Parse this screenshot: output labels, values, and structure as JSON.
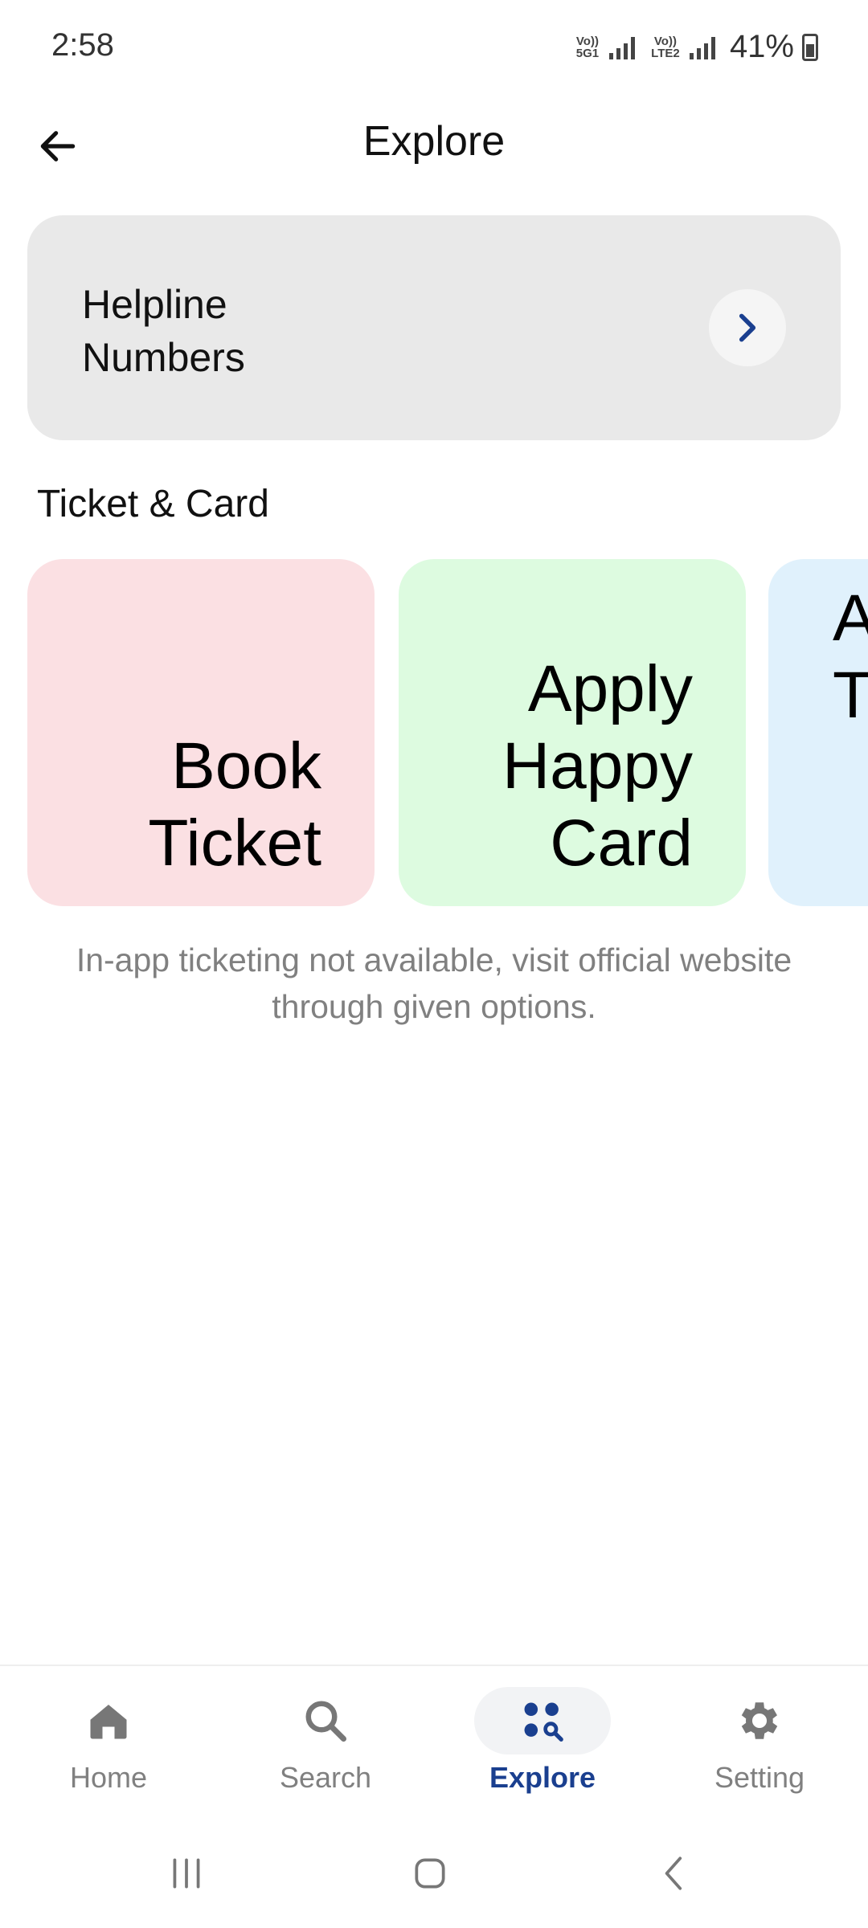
{
  "status_bar": {
    "time": "2:58",
    "net1": "Vo)) 5G1",
    "net2": "Vo)) LTE2",
    "battery": "41%"
  },
  "header": {
    "title": "Explore"
  },
  "helpline": {
    "label": "Helpline Numbers"
  },
  "section": {
    "title": "Ticket & Card"
  },
  "tiles": [
    {
      "label": "Book Ticket",
      "color": "#fbe0e3"
    },
    {
      "label": "Apply Happy Card",
      "color": "#ddfbe0"
    },
    {
      "label": "A T",
      "color": "#e0f1fc"
    }
  ],
  "note": "In-app ticketing not available, visit official website through given options.",
  "bottom_nav": {
    "items": [
      {
        "label": "Home",
        "icon": "home-icon"
      },
      {
        "label": "Search",
        "icon": "search-icon"
      },
      {
        "label": "Explore",
        "icon": "explore-icon",
        "active": true
      },
      {
        "label": "Setting",
        "icon": "gear-icon"
      }
    ]
  },
  "colors": {
    "accent": "#1a3f8f",
    "card_bg": "#e9e9e9",
    "muted_text": "#808080"
  }
}
